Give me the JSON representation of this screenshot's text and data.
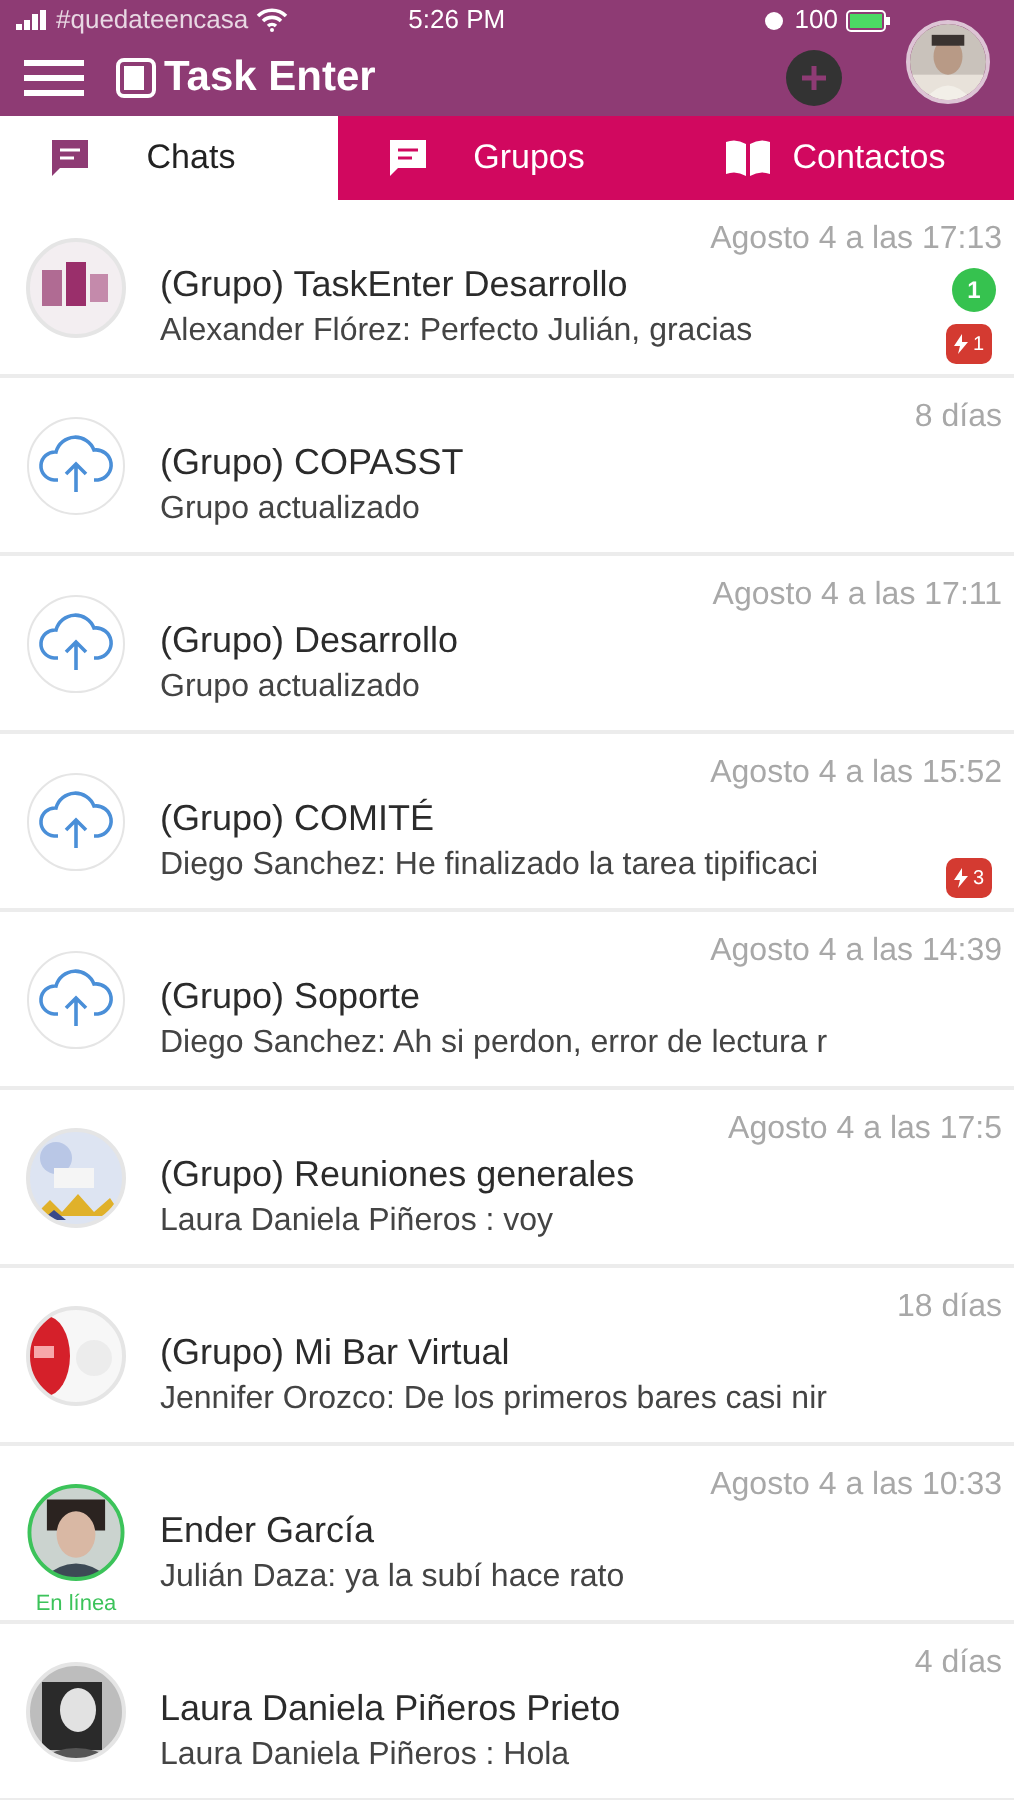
{
  "status_bar": {
    "carrier": "#quedateencasa",
    "time": "5:26 PM",
    "battery": "100"
  },
  "header": {
    "title": "Task Enter"
  },
  "tabs": [
    {
      "label": "Chats",
      "selected": true,
      "kind": "chat"
    },
    {
      "label": "Grupos",
      "selected": false,
      "kind": "chat"
    },
    {
      "label": "Contactos",
      "selected": false,
      "kind": "book"
    }
  ],
  "chats": [
    {
      "kind": "picture",
      "title": "(Grupo) TaskEnter Desarrollo",
      "preview": "Alexander Flórez: Perfecto Julián, gracias",
      "time": "Agosto 4 a las 17:13",
      "unread": "1",
      "alerts": "1",
      "online": false
    },
    {
      "kind": "cloud",
      "title": "(Grupo) COPASST",
      "preview": "Grupo actualizado",
      "time": "8 días",
      "online": false
    },
    {
      "kind": "cloud",
      "title": "(Grupo) Desarrollo",
      "preview": "Grupo actualizado",
      "time": "Agosto 4 a las 17:11",
      "online": false
    },
    {
      "kind": "cloud",
      "title": "(Grupo) COMITÉ",
      "preview": "Diego Sanchez: He finalizado la tarea tipificaci",
      "time": "Agosto 4 a las 15:52",
      "alerts": "3",
      "online": false
    },
    {
      "kind": "cloud",
      "title": "(Grupo) Soporte",
      "preview": "Diego Sanchez: Ah si perdon, error de lectura r",
      "time": "Agosto 4 a las 14:39",
      "online": false
    },
    {
      "kind": "picture",
      "title": "(Grupo) Reuniones generales",
      "preview": "Laura Daniela Piñeros : voy",
      "time": "Agosto 4 a las 17:5",
      "online": false
    },
    {
      "kind": "picture",
      "title": "(Grupo) Mi Bar Virtual",
      "preview": "Jennifer Orozco: De los primeros bares casi nir",
      "time": "18 días",
      "online": false
    },
    {
      "kind": "picture",
      "title": "Ender García",
      "preview": "Julián Daza: ya la subí hace rato",
      "time": "Agosto 4 a las 10:33",
      "online": true,
      "online_label": "En línea"
    },
    {
      "kind": "picture",
      "title": "Laura Daniela Piñeros Prieto",
      "preview": "Laura Daniela Piñeros : Hola",
      "time": "4 días",
      "online": false
    }
  ]
}
